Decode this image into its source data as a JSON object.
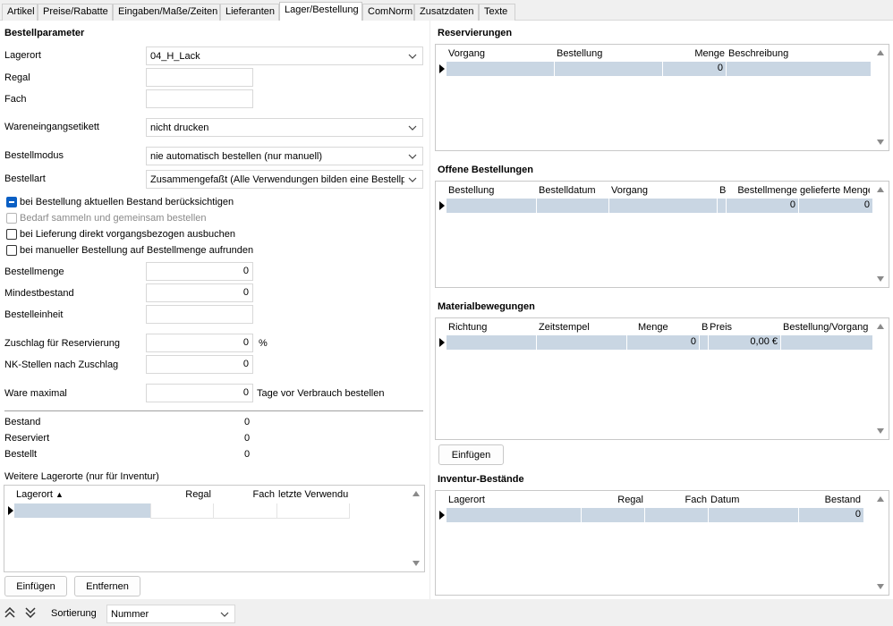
{
  "tabs": [
    {
      "label": "Artikel",
      "active": false
    },
    {
      "label": "Preise/Rabatte",
      "active": false
    },
    {
      "label": "Eingaben/Maße/Zeiten",
      "active": false
    },
    {
      "label": "Lieferanten",
      "active": false
    },
    {
      "label": "Lager/Bestellung",
      "active": true
    },
    {
      "label": "ComNorm",
      "active": false
    },
    {
      "label": "Zusatzdaten",
      "active": false
    },
    {
      "label": "Texte",
      "active": false
    }
  ],
  "left": {
    "title": "Bestellparameter",
    "lagerort": {
      "label": "Lagerort",
      "value": "04_H_Lack"
    },
    "regal": {
      "label": "Regal",
      "value": ""
    },
    "fach": {
      "label": "Fach",
      "value": ""
    },
    "wareneingang": {
      "label": "Wareneingangsetikett",
      "value": "nicht drucken"
    },
    "bestellmodus": {
      "label": "Bestellmodus",
      "value": "nie automatisch bestellen (nur manuell)"
    },
    "bestellart": {
      "label": "Bestellart",
      "value": "Zusammengefaßt (Alle Verwendungen bilden eine Bestellposition)"
    },
    "checks": [
      {
        "label": "bei Bestellung aktuellen Bestand berücksichtigen",
        "checked": true,
        "disabled": false
      },
      {
        "label": "Bedarf sammeln und gemeinsam bestellen",
        "checked": false,
        "disabled": true
      },
      {
        "label": "bei Lieferung direkt vorgangsbezogen ausbuchen",
        "checked": false,
        "disabled": false
      },
      {
        "label": "bei manueller Bestellung auf Bestellmenge aufrunden",
        "checked": false,
        "disabled": false
      }
    ],
    "bestellmenge": {
      "label": "Bestellmenge",
      "value": "0"
    },
    "mindestbestand": {
      "label": "Mindestbestand",
      "value": "0"
    },
    "bestelleinheit": {
      "label": "Bestelleinheit",
      "value": ""
    },
    "zuschlag": {
      "label": "Zuschlag für Reservierung",
      "value": "0",
      "unit": "%"
    },
    "nkstellen": {
      "label": "NK-Stellen nach Zuschlag",
      "value": "0"
    },
    "ware": {
      "label": "Ware maximal",
      "value": "0",
      "suffix": "Tage vor Verbrauch bestellen"
    },
    "bestand": {
      "label": "Bestand",
      "value": "0"
    },
    "reserviert": {
      "label": "Reserviert",
      "value": "0"
    },
    "bestellt": {
      "label": "Bestellt",
      "value": "0"
    },
    "weitere": {
      "title": "Weitere Lagerorte (nur für Inventur)",
      "headers": [
        "Lagerort",
        "Regal",
        "Fach",
        "letzte Verwendu"
      ],
      "sort_indicator": "▲"
    },
    "buttons": {
      "insert": "Einfügen",
      "remove": "Entfernen"
    }
  },
  "right": {
    "reservierungen": {
      "title": "Reservierungen",
      "headers": [
        "Vorgang",
        "Bestellung",
        "Menge",
        "Beschreibung"
      ],
      "row": [
        "",
        "",
        "0",
        ""
      ]
    },
    "offene": {
      "title": "Offene Bestellungen",
      "headers": [
        "Bestellung",
        "Bestelldatum",
        "Vorgang",
        "Be",
        "Bestellmenge",
        "gelieferte Menge"
      ],
      "row": [
        "",
        "",
        "",
        "",
        "0",
        "0"
      ]
    },
    "material": {
      "title": "Materialbewegungen",
      "headers": [
        "Richtung",
        "Zeitstempel",
        "Menge",
        "Be",
        "Preis",
        "Bestellung/Vorgang"
      ],
      "row": [
        "",
        "",
        "0",
        "",
        "0,00 €",
        ""
      ],
      "button": "Einfügen"
    },
    "inventur": {
      "title": "Inventur-Bestände",
      "headers": [
        "Lagerort",
        "Regal",
        "Fach",
        "Datum",
        "Bestand"
      ],
      "row": [
        "",
        "",
        "",
        "",
        "0"
      ]
    }
  },
  "status": {
    "sort_label": "Sortierung",
    "sort_value": "Nummer"
  },
  "colors": {
    "row_selected": "#c9d6e3",
    "accent": "#0a5fc4"
  }
}
